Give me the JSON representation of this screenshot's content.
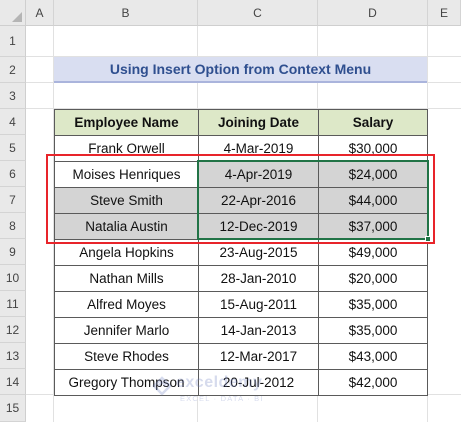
{
  "columns": [
    "A",
    "B",
    "C",
    "D",
    "E"
  ],
  "rows": [
    "1",
    "2",
    "3",
    "4",
    "5",
    "6",
    "7",
    "8",
    "9",
    "10",
    "11",
    "12",
    "13",
    "14",
    "15"
  ],
  "title": "Using Insert Option from Context Menu",
  "table": {
    "headers": [
      "Employee Name",
      "Joining Date",
      "Salary"
    ],
    "rows": [
      {
        "name": "Frank Orwell",
        "date": "4-Mar-2019",
        "salary": "$30,000"
      },
      {
        "name": "Moises Henriques",
        "date": "4-Apr-2019",
        "salary": "$24,000"
      },
      {
        "name": "Steve Smith",
        "date": "22-Apr-2016",
        "salary": "$44,000"
      },
      {
        "name": "Natalia Austin",
        "date": "12-Dec-2019",
        "salary": "$37,000"
      },
      {
        "name": "Angela Hopkins",
        "date": "23-Aug-2015",
        "salary": "$49,000"
      },
      {
        "name": "Nathan Mills",
        "date": "28-Jan-2010",
        "salary": "$20,000"
      },
      {
        "name": "Alfred Moyes",
        "date": "15-Aug-2011",
        "salary": "$35,000"
      },
      {
        "name": "Jennifer Marlo",
        "date": "14-Jan-2013",
        "salary": "$35,000"
      },
      {
        "name": "Steve Rhodes",
        "date": "12-Mar-2017",
        "salary": "$43,000"
      },
      {
        "name": "Gregory Thompson",
        "date": "20-Jul-2012",
        "salary": "$42,000"
      }
    ]
  },
  "watermark": {
    "name": "exceldemy",
    "tagline": "EXCEL · DATA · BI"
  },
  "colors": {
    "highlight_box": "#e8242a",
    "selection_border": "#217346",
    "header_fill": "#dde8c8",
    "title_fill": "#d9def1"
  }
}
